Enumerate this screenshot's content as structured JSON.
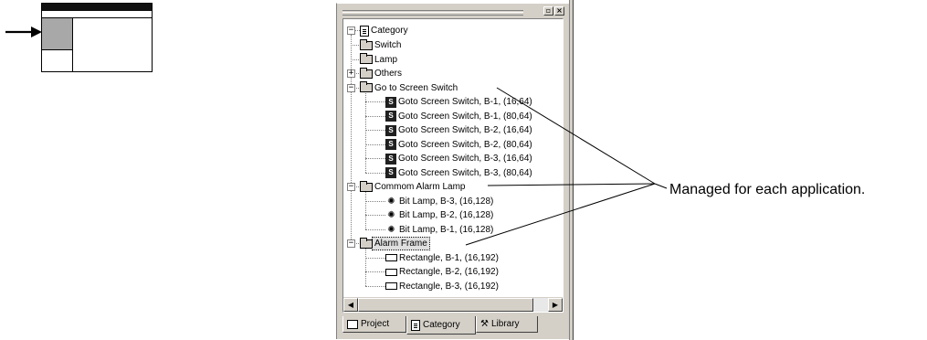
{
  "window": {
    "caption_buttons": [
      "restore",
      "close"
    ]
  },
  "tree": {
    "root": {
      "label": "Category",
      "icon": "document-icon"
    },
    "nodes": [
      {
        "label": "Switch",
        "icon": "folder-icon",
        "level": 1,
        "expander": ""
      },
      {
        "label": "Lamp",
        "icon": "folder-icon",
        "level": 1,
        "expander": ""
      },
      {
        "label": "Others",
        "icon": "folder-icon",
        "level": 1,
        "expander": "+"
      },
      {
        "label": "Go to Screen Switch",
        "icon": "folder-icon",
        "level": 1,
        "expander": "−"
      },
      {
        "label": "Goto Screen Switch, B-1, (16,64)",
        "icon": "switch-icon",
        "level": 2
      },
      {
        "label": "Goto Screen Switch, B-1, (80,64)",
        "icon": "switch-icon",
        "level": 2
      },
      {
        "label": "Goto Screen Switch, B-2, (16,64)",
        "icon": "switch-icon",
        "level": 2
      },
      {
        "label": "Goto Screen Switch, B-2, (80,64)",
        "icon": "switch-icon",
        "level": 2
      },
      {
        "label": "Goto Screen Switch, B-3, (16,64)",
        "icon": "switch-icon",
        "level": 2
      },
      {
        "label": "Goto Screen Switch, B-3, (80,64)",
        "icon": "switch-icon",
        "level": 2
      },
      {
        "label": "Commom Alarm Lamp",
        "icon": "folder-icon",
        "level": 1,
        "expander": "−"
      },
      {
        "label": "Bit Lamp, B-3, (16,128)",
        "icon": "lamp-icon",
        "level": 2
      },
      {
        "label": "Bit Lamp, B-2, (16,128)",
        "icon": "lamp-icon",
        "level": 2
      },
      {
        "label": "Bit Lamp, B-1, (16,128)",
        "icon": "lamp-icon",
        "level": 2
      },
      {
        "label": "Alarm Frame",
        "icon": "folder-icon",
        "level": 1,
        "expander": "−",
        "selected": true
      },
      {
        "label": "Rectangle, B-1, (16,192)",
        "icon": "rectangle-icon",
        "level": 2
      },
      {
        "label": "Rectangle, B-2, (16,192)",
        "icon": "rectangle-icon",
        "level": 2
      },
      {
        "label": "Rectangle, B-3, (16,192)",
        "icon": "rectangle-icon",
        "level": 2
      }
    ]
  },
  "tabs": [
    {
      "label": "Project",
      "icon": "project-icon"
    },
    {
      "label": "Category",
      "icon": "category-icon",
      "active": true
    },
    {
      "label": "Library",
      "icon": "tools-icon"
    }
  ],
  "callout": {
    "text": "Managed for each application."
  }
}
